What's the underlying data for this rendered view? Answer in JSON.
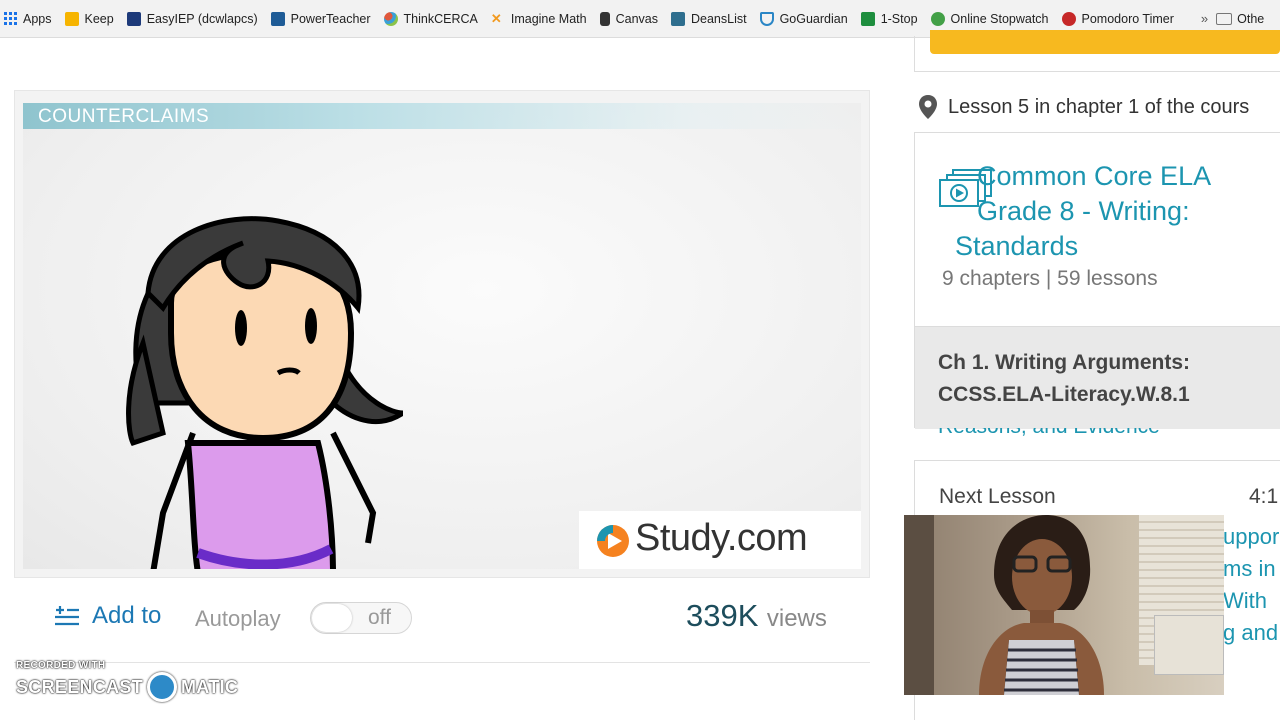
{
  "bookmarks": [
    {
      "label": "Apps",
      "icon": "apps-grid-icon",
      "color": "#1a73e8"
    },
    {
      "label": "Keep",
      "icon": "keep-icon",
      "color": "#f6b400"
    },
    {
      "label": "EasyIEP (dcwlapcs)",
      "icon": "easyiep-icon",
      "color": "#1d3a7a"
    },
    {
      "label": "PowerTeacher",
      "icon": "powerteacher-icon",
      "color": "#1e5b96"
    },
    {
      "label": "ThinkCERCA",
      "icon": "thinkcerca-icon",
      "color": "#e0583c"
    },
    {
      "label": "Imagine Math",
      "icon": "imagine-math-icon",
      "color": "#f29a1f"
    },
    {
      "label": "Canvas",
      "icon": "canvas-icon",
      "color": "#333333"
    },
    {
      "label": "DeansList",
      "icon": "deanslist-icon",
      "color": "#2e6e8e"
    },
    {
      "label": "GoGuardian",
      "icon": "goguardian-icon",
      "color": "#2a86c6"
    },
    {
      "label": "1-Stop",
      "icon": "sheet-icon",
      "color": "#1e8e3e"
    },
    {
      "label": "Online Stopwatch",
      "icon": "stopwatch-icon",
      "color": "#43a047"
    },
    {
      "label": "Pomodoro Timer",
      "icon": "tomato-icon",
      "color": "#c62828"
    }
  ],
  "other_bookmarks": "Othe",
  "video": {
    "banner": "COUNTERCLAIMS",
    "brand": "Study.com"
  },
  "controls": {
    "add_to": "Add to",
    "autoplay": "Autoplay",
    "toggle_state": "off",
    "views_count": "339K",
    "views_label": "views"
  },
  "watermark": {
    "recorded_with": "RECORDED WITH",
    "left": "SCREENCAST",
    "right": "MATIC"
  },
  "sidebar": {
    "lesson_position": "Lesson 5 in chapter 1 of the cours",
    "course_title_line1": "Common Core ELA",
    "course_title_line2": "Grade 8 - Writing:",
    "course_title_line3": "Standards",
    "course_meta": "9 chapters | 59 lessons",
    "chapter_line1": "Ch 1. Writing Arguments:",
    "chapter_line2": "CCSS.ELA-Literacy.W.8.1",
    "partial_lesson": "Reasons, and Evidence",
    "next_label": "Next Lesson",
    "next_duration": "4:1",
    "next_text": [
      "uppor",
      "ms in",
      "With",
      "g and"
    ]
  },
  "colors": {
    "accent_teal": "#1c95b0",
    "link_blue": "#1c78b4",
    "cta_yellow": "#f7b91f"
  }
}
